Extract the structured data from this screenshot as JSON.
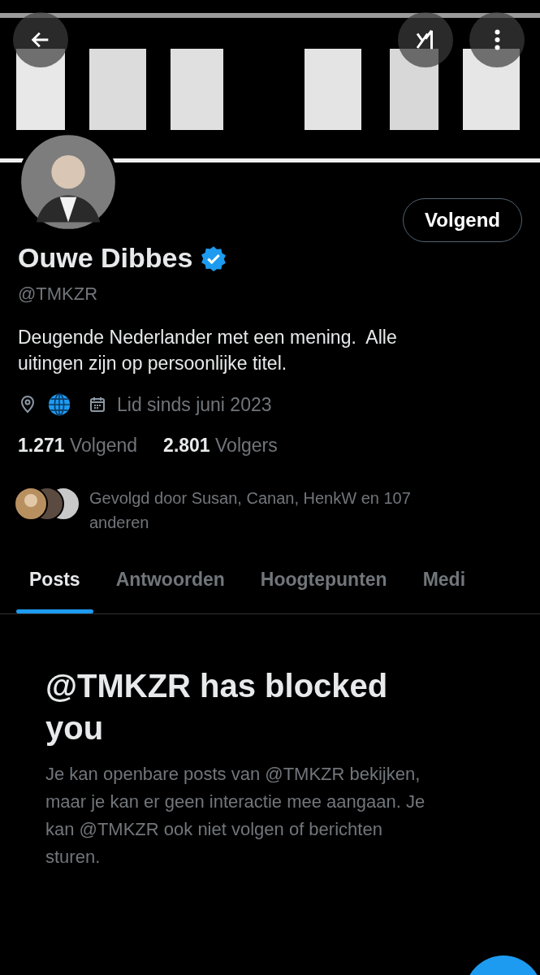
{
  "profile": {
    "name": "Ouwe Dibbes",
    "verified": true,
    "handle": "@TMKZR",
    "follow_button": "Volgend",
    "bio": "Deugende Nederlander met een mening.  Alle uitingen zijn op persoonlijke titel.",
    "joined": "Lid sinds juni 2023",
    "stats": [
      {
        "count": "1.271",
        "label": "Volgend"
      },
      {
        "count": "2.801",
        "label": "Volgers"
      }
    ],
    "followed_by": "Gevolgd door Susan, Canan, HenkW en 107 anderen"
  },
  "tabs": [
    {
      "label": "Posts",
      "selected": true
    },
    {
      "label": "Antwoorden",
      "selected": false
    },
    {
      "label": "Hoogtepunten",
      "selected": false
    },
    {
      "label": "Medi",
      "selected": false
    }
  ],
  "blocked": {
    "title": "@TMKZR has blocked you",
    "text": "Je kan openbare posts van @TMKZR bekijken, maar je kan er geen interactie mee aangaan. Je kan @TMKZR ook niet volgen of berichten sturen."
  }
}
